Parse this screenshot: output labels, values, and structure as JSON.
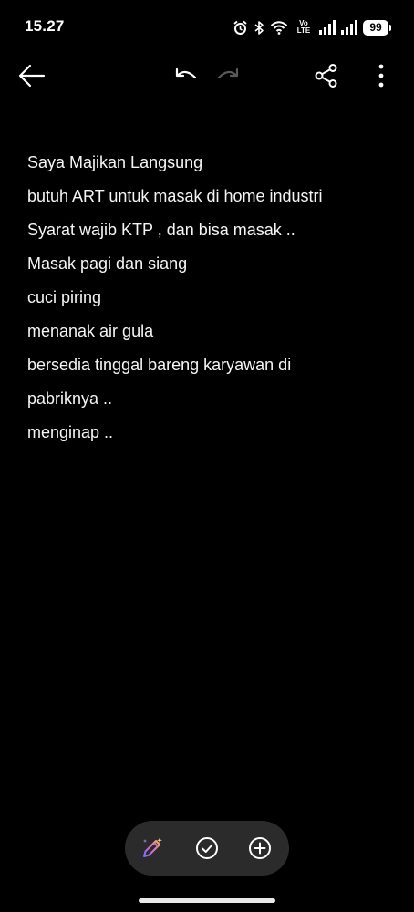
{
  "status_bar": {
    "time": "15.27",
    "network_label_top": "Vo",
    "network_label_bottom": "LTE",
    "battery": "99"
  },
  "toolbar": {
    "icons": [
      "back-arrow-icon",
      "undo-icon",
      "redo-icon",
      "share-icon",
      "more-vertical-icon"
    ]
  },
  "note": {
    "lines": [
      "Saya Majikan Langsung",
      "butuh ART untuk masak di home industri",
      "Syarat wajib KTP , dan bisa masak ..",
      "Masak pagi dan siang",
      "cuci piring",
      "menanak air gula",
      "bersedia tinggal bareng karyawan di",
      "pabriknya ..",
      "menginap .."
    ]
  },
  "bottom_bar": {
    "icons": [
      "ai-pen-icon",
      "checklist-icon",
      "add-icon"
    ]
  }
}
